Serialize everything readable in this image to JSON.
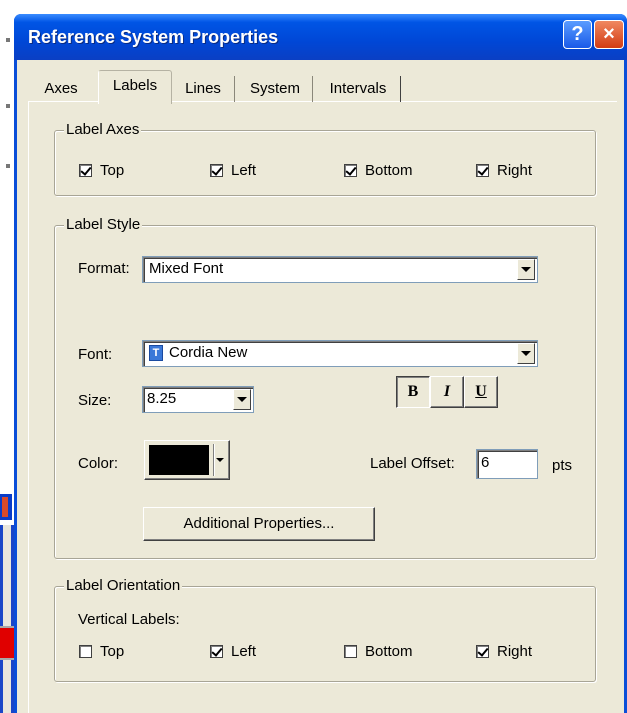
{
  "window": {
    "title": "Reference System Properties",
    "help_label": "?",
    "close_label": "×"
  },
  "tabs": [
    {
      "label": "Axes"
    },
    {
      "label": "Labels",
      "active": true
    },
    {
      "label": "Lines"
    },
    {
      "label": "System"
    },
    {
      "label": "Intervals"
    }
  ],
  "label_axes": {
    "legend": "Label Axes",
    "items": [
      {
        "label": "Top",
        "checked": true
      },
      {
        "label": "Left",
        "checked": true
      },
      {
        "label": "Bottom",
        "checked": true
      },
      {
        "label": "Right",
        "checked": true
      }
    ]
  },
  "label_style": {
    "legend": "Label Style",
    "format_label": "Format:",
    "format_value": "Mixed Font",
    "font_label": "Font:",
    "font_value": "Cordia New",
    "font_icon_glyph": "T",
    "size_label": "Size:",
    "size_value": "8.25",
    "bold_label": "B",
    "italic_label": "I",
    "underline_label": "U",
    "bold_pressed": true,
    "color_label": "Color:",
    "color_value": "#000000",
    "offset_label": "Label Offset:",
    "offset_value": "6",
    "offset_unit": "pts",
    "additional_button": "Additional Properties..."
  },
  "label_orientation": {
    "legend": "Label Orientation",
    "subheading": "Vertical Labels:",
    "items": [
      {
        "label": "Top",
        "checked": false
      },
      {
        "label": "Left",
        "checked": true
      },
      {
        "label": "Bottom",
        "checked": false
      },
      {
        "label": "Right",
        "checked": true
      }
    ]
  }
}
